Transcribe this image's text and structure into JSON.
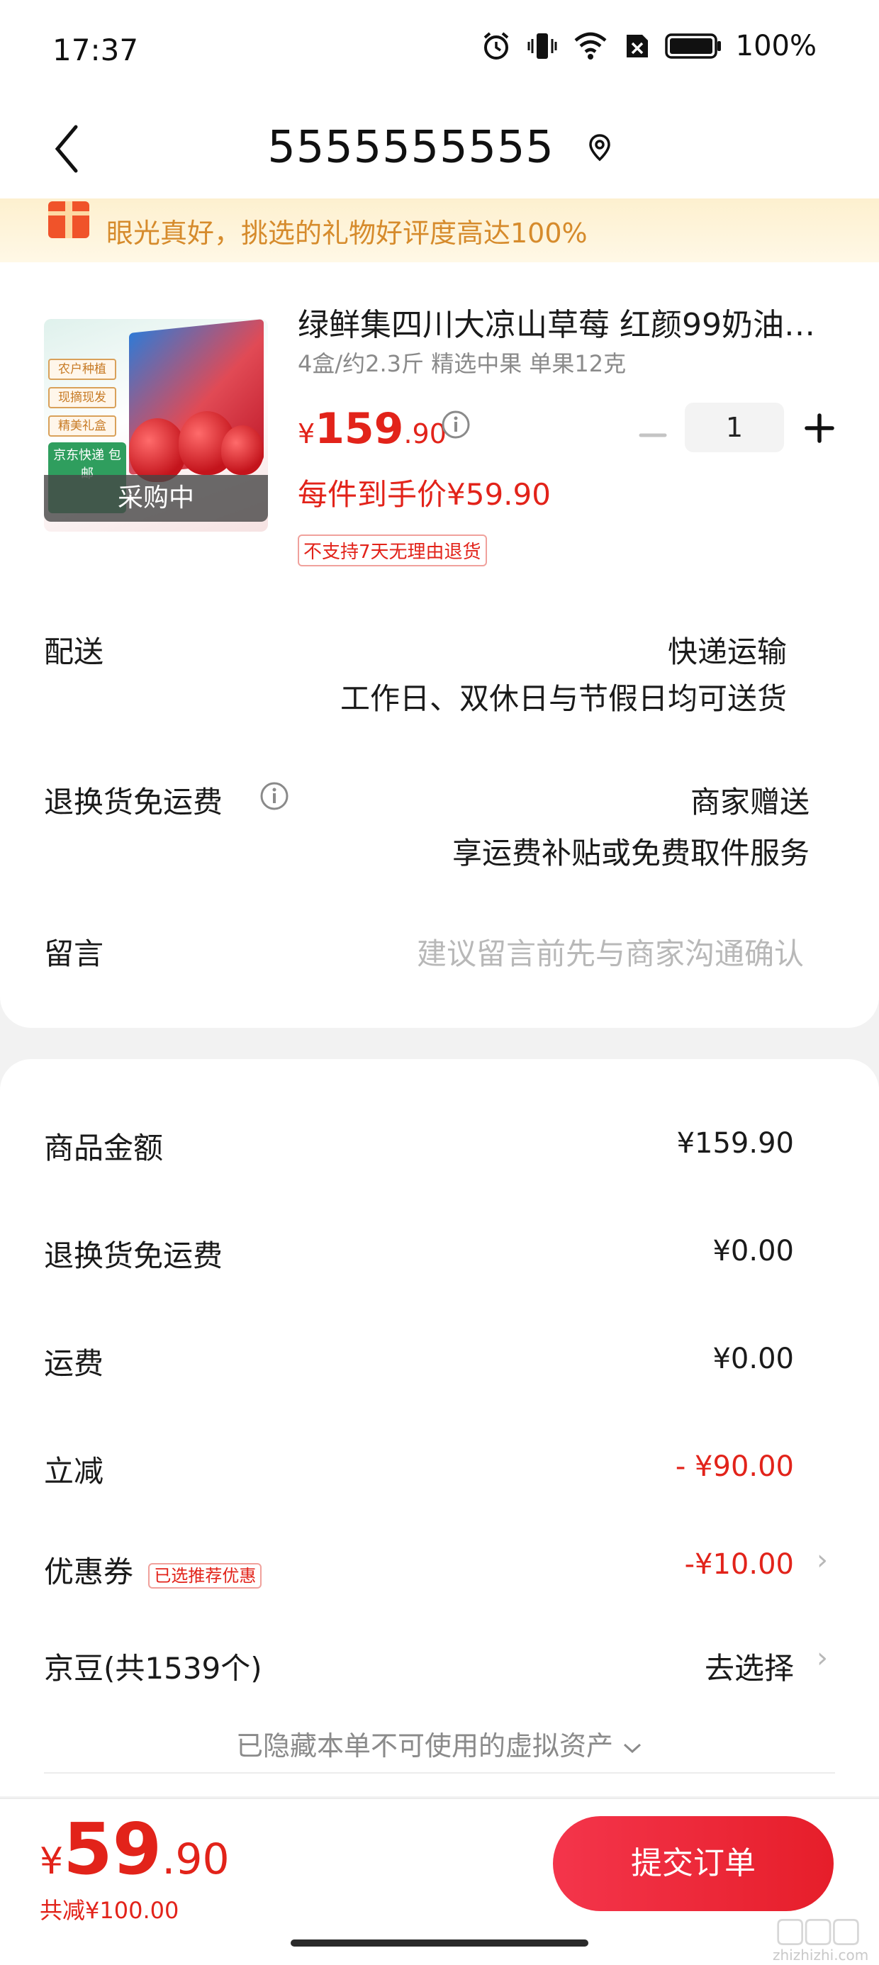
{
  "status_bar": {
    "time": "17:37",
    "battery": "100%"
  },
  "nav": {
    "title": "5555555555"
  },
  "banner": {
    "text": "眼光真好，挑选的礼物好评度高达100%"
  },
  "product": {
    "title": "绿鲜集四川大凉山草莓 红颜99奶油…",
    "spec": "4盒/约2.3斤 精选中果 单果12克",
    "price_currency": "¥",
    "price_int": "159",
    "price_dec": ".90",
    "quantity": "1",
    "hand_price": "每件到手价¥59.90",
    "no_return": "不支持7天无理由退货",
    "image_status": "采购中",
    "image_tags": [
      "农户种植",
      "现摘现发",
      "精美礼盒"
    ],
    "image_green_tag": "京东快递 包邮"
  },
  "delivery": {
    "label": "配送",
    "method": "快递运输",
    "note": "工作日、双休日与节假日均可送货"
  },
  "return_shipping": {
    "label": "退换货免运费",
    "value": "商家赠送",
    "note": "享运费补贴或免费取件服务"
  },
  "message": {
    "label": "留言",
    "placeholder": "建议留言前先与商家沟通确认"
  },
  "summary": {
    "goods_amount": {
      "label": "商品金额",
      "value": "¥159.90"
    },
    "return_fee": {
      "label": "退换货免运费",
      "value": "¥0.00"
    },
    "shipping": {
      "label": "运费",
      "value": "¥0.00"
    },
    "instant_discount": {
      "label": "立减",
      "value": "- ¥90.00"
    },
    "coupon": {
      "label": "优惠券",
      "tag": "已选推荐优惠",
      "value": "-¥10.00"
    },
    "jingdou": {
      "label": "京豆(共1539个)",
      "value": "去选择"
    },
    "hidden_assets": "已隐藏本单不可使用的虚拟资产"
  },
  "bottom": {
    "currency": "¥",
    "total_int": "59",
    "total_dec": ".90",
    "total_reduce": "共减¥100.00",
    "submit": "提交订单"
  },
  "watermark": "zhizhizhi.com",
  "colors": {
    "accent": "#e2231a",
    "banner_text": "#d68b2c",
    "banner_bg": "#fdf0cf"
  }
}
